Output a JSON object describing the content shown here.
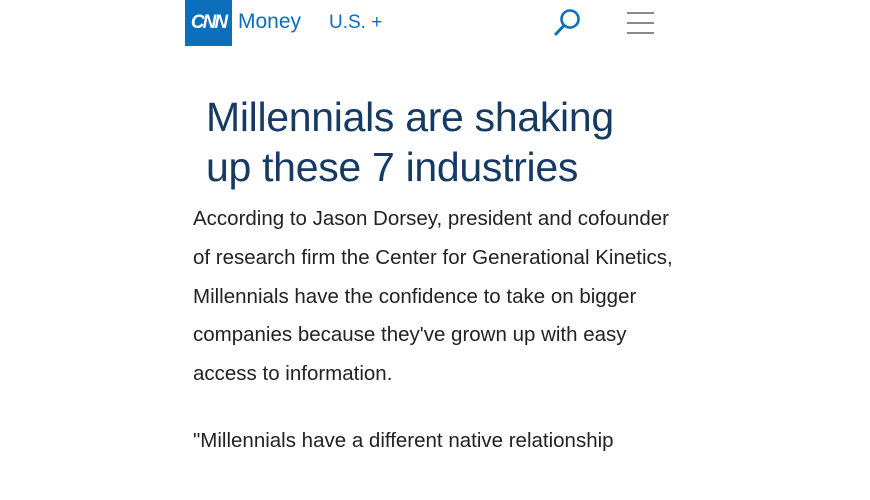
{
  "header": {
    "logo_text": "CNN",
    "brand": "Money",
    "edition": "U.S. +",
    "icons": {
      "search": "search-icon",
      "menu": "hamburger-menu-icon"
    },
    "colors": {
      "brand_blue": "#0c6fbb",
      "headline_navy": "#173a63",
      "menu_gray": "#8a8a8a"
    }
  },
  "article": {
    "headline": "Millennials are shaking up these 7 industries",
    "paragraphs": [
      "According to Jason Dorsey, president and cofounder of research firm the Center for Generational Kinetics, Millennials have the confidence to take on bigger companies because they've grown up with easy access to information.",
      "\"Millennials have a different native relationship"
    ]
  }
}
